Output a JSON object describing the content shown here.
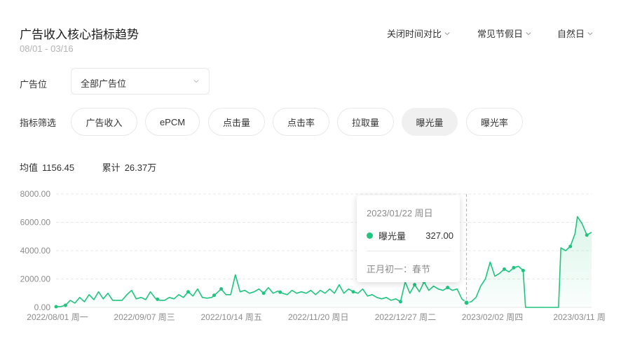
{
  "header": {
    "title": "广告收入核心指标趋势",
    "date_range": "08/01 - 03/16",
    "controls": [
      "关闭时间对比",
      "常见节假日",
      "自然日"
    ]
  },
  "filters": {
    "slot_label": "广告位",
    "slot_value": "全部广告位",
    "metric_label": "指标筛选",
    "metrics": [
      "广告收入",
      "ePCM",
      "点击量",
      "点击率",
      "拉取量",
      "曝光量",
      "曝光率"
    ],
    "active_metric": "曝光量"
  },
  "stats": {
    "avg_label": "均值",
    "avg_value": "1156.45",
    "total_label": "累计",
    "total_value": "26.37万"
  },
  "tooltip": {
    "date": "2023/01/22 周日",
    "series": "曝光量",
    "value": "327.00",
    "note": "正月初一：春节"
  },
  "colors": {
    "line": "#1fc47e",
    "fill": "#e8f8f0",
    "grid": "#e8e8e8"
  },
  "chart_data": {
    "type": "area",
    "y_ticks": [
      "8000.00",
      "6000.00",
      "4000.00",
      "2000.00",
      "0.00"
    ],
    "ylim": [
      0,
      8000
    ],
    "x_ticks": [
      "2022/08/01 周一",
      "2022/09/07 周三",
      "2022/10/14 周五",
      "2022/11/20 周日",
      "2022/12/27 周二",
      "2023/02/02 周四",
      "2023/03/11 周"
    ],
    "x_start": "2022-08-01",
    "x_end": "2023-03-16",
    "points": [
      [
        "2022-08-01",
        50
      ],
      [
        "2022-08-03",
        60
      ],
      [
        "2022-08-05",
        150
      ],
      [
        "2022-08-07",
        500
      ],
      [
        "2022-08-09",
        300
      ],
      [
        "2022-08-11",
        700
      ],
      [
        "2022-08-13",
        400
      ],
      [
        "2022-08-15",
        900
      ],
      [
        "2022-08-17",
        550
      ],
      [
        "2022-08-19",
        1100
      ],
      [
        "2022-08-21",
        600
      ],
      [
        "2022-08-23",
        1000
      ],
      [
        "2022-08-25",
        500
      ],
      [
        "2022-08-27",
        500
      ],
      [
        "2022-08-29",
        500
      ],
      [
        "2022-08-31",
        900
      ],
      [
        "2022-09-02",
        1200
      ],
      [
        "2022-09-04",
        600
      ],
      [
        "2022-09-06",
        700
      ],
      [
        "2022-09-08",
        550
      ],
      [
        "2022-09-10",
        1100
      ],
      [
        "2022-09-12",
        650
      ],
      [
        "2022-09-14",
        500
      ],
      [
        "2022-09-16",
        500
      ],
      [
        "2022-09-18",
        700
      ],
      [
        "2022-09-20",
        600
      ],
      [
        "2022-09-22",
        900
      ],
      [
        "2022-09-24",
        700
      ],
      [
        "2022-09-26",
        1100
      ],
      [
        "2022-09-28",
        800
      ],
      [
        "2022-09-30",
        1300
      ],
      [
        "2022-10-02",
        700
      ],
      [
        "2022-10-04",
        650
      ],
      [
        "2022-10-06",
        700
      ],
      [
        "2022-10-08",
        1000
      ],
      [
        "2022-10-10",
        1300
      ],
      [
        "2022-10-12",
        900
      ],
      [
        "2022-10-14",
        900
      ],
      [
        "2022-10-16",
        2300
      ],
      [
        "2022-10-18",
        1100
      ],
      [
        "2022-10-20",
        1200
      ],
      [
        "2022-10-22",
        1000
      ],
      [
        "2022-10-24",
        1100
      ],
      [
        "2022-10-26",
        1300
      ],
      [
        "2022-10-28",
        1000
      ],
      [
        "2022-10-30",
        1400
      ],
      [
        "2022-11-01",
        1000
      ],
      [
        "2022-11-03",
        1150
      ],
      [
        "2022-11-05",
        1000
      ],
      [
        "2022-11-07",
        900
      ],
      [
        "2022-11-09",
        1200
      ],
      [
        "2022-11-11",
        1000
      ],
      [
        "2022-11-13",
        1100
      ],
      [
        "2022-11-15",
        1000
      ],
      [
        "2022-11-17",
        1200
      ],
      [
        "2022-11-19",
        900
      ],
      [
        "2022-11-21",
        1200
      ],
      [
        "2022-11-23",
        1000
      ],
      [
        "2022-11-25",
        1300
      ],
      [
        "2022-11-27",
        1000
      ],
      [
        "2022-11-29",
        1600
      ],
      [
        "2022-12-01",
        1000
      ],
      [
        "2022-12-03",
        1300
      ],
      [
        "2022-12-05",
        1100
      ],
      [
        "2022-12-07",
        1000
      ],
      [
        "2022-12-09",
        1300
      ],
      [
        "2022-12-11",
        800
      ],
      [
        "2022-12-13",
        900
      ],
      [
        "2022-12-15",
        700
      ],
      [
        "2022-12-17",
        600
      ],
      [
        "2022-12-19",
        700
      ],
      [
        "2022-12-21",
        500
      ],
      [
        "2022-12-23",
        600
      ],
      [
        "2022-12-25",
        400
      ],
      [
        "2022-12-27",
        1800
      ],
      [
        "2022-12-29",
        1000
      ],
      [
        "2022-12-31",
        1600
      ],
      [
        "2023-01-02",
        1100
      ],
      [
        "2023-01-04",
        1800
      ],
      [
        "2023-01-06",
        1200
      ],
      [
        "2023-01-08",
        1500
      ],
      [
        "2023-01-10",
        1300
      ],
      [
        "2023-01-12",
        1200
      ],
      [
        "2023-01-14",
        1400
      ],
      [
        "2023-01-16",
        1200
      ],
      [
        "2023-01-18",
        1300
      ],
      [
        "2023-01-20",
        600
      ],
      [
        "2023-01-22",
        327
      ],
      [
        "2023-01-24",
        400
      ],
      [
        "2023-01-26",
        700
      ],
      [
        "2023-01-28",
        1500
      ],
      [
        "2023-01-30",
        2000
      ],
      [
        "2023-02-01",
        3200
      ],
      [
        "2023-02-03",
        2200
      ],
      [
        "2023-02-05",
        2400
      ],
      [
        "2023-02-07",
        2700
      ],
      [
        "2023-02-09",
        2500
      ],
      [
        "2023-02-11",
        2800
      ],
      [
        "2023-02-13",
        2900
      ],
      [
        "2023-02-15",
        2600
      ],
      [
        "2023-02-16",
        0
      ],
      [
        "2023-02-18",
        0
      ],
      [
        "2023-02-20",
        0
      ],
      [
        "2023-02-22",
        0
      ],
      [
        "2023-02-24",
        0
      ],
      [
        "2023-02-26",
        0
      ],
      [
        "2023-02-28",
        0
      ],
      [
        "2023-03-02",
        0
      ],
      [
        "2023-03-03",
        4200
      ],
      [
        "2023-03-05",
        4000
      ],
      [
        "2023-03-07",
        4300
      ],
      [
        "2023-03-09",
        5200
      ],
      [
        "2023-03-10",
        6400
      ],
      [
        "2023-03-12",
        5900
      ],
      [
        "2023-03-14",
        5100
      ],
      [
        "2023-03-16",
        5300
      ]
    ],
    "marker_dates": [
      "2022-08-01",
      "2022-08-05",
      "2022-09-13",
      "2022-09-26",
      "2022-10-07",
      "2022-10-10",
      "2022-10-28",
      "2022-11-04",
      "2022-12-05",
      "2022-12-25",
      "2022-12-31",
      "2023-01-04",
      "2023-01-14",
      "2023-01-22",
      "2023-02-07",
      "2023-02-11",
      "2023-02-15",
      "2023-03-07",
      "2023-03-14"
    ],
    "tooltip_date": "2023-01-22",
    "grid": true
  }
}
